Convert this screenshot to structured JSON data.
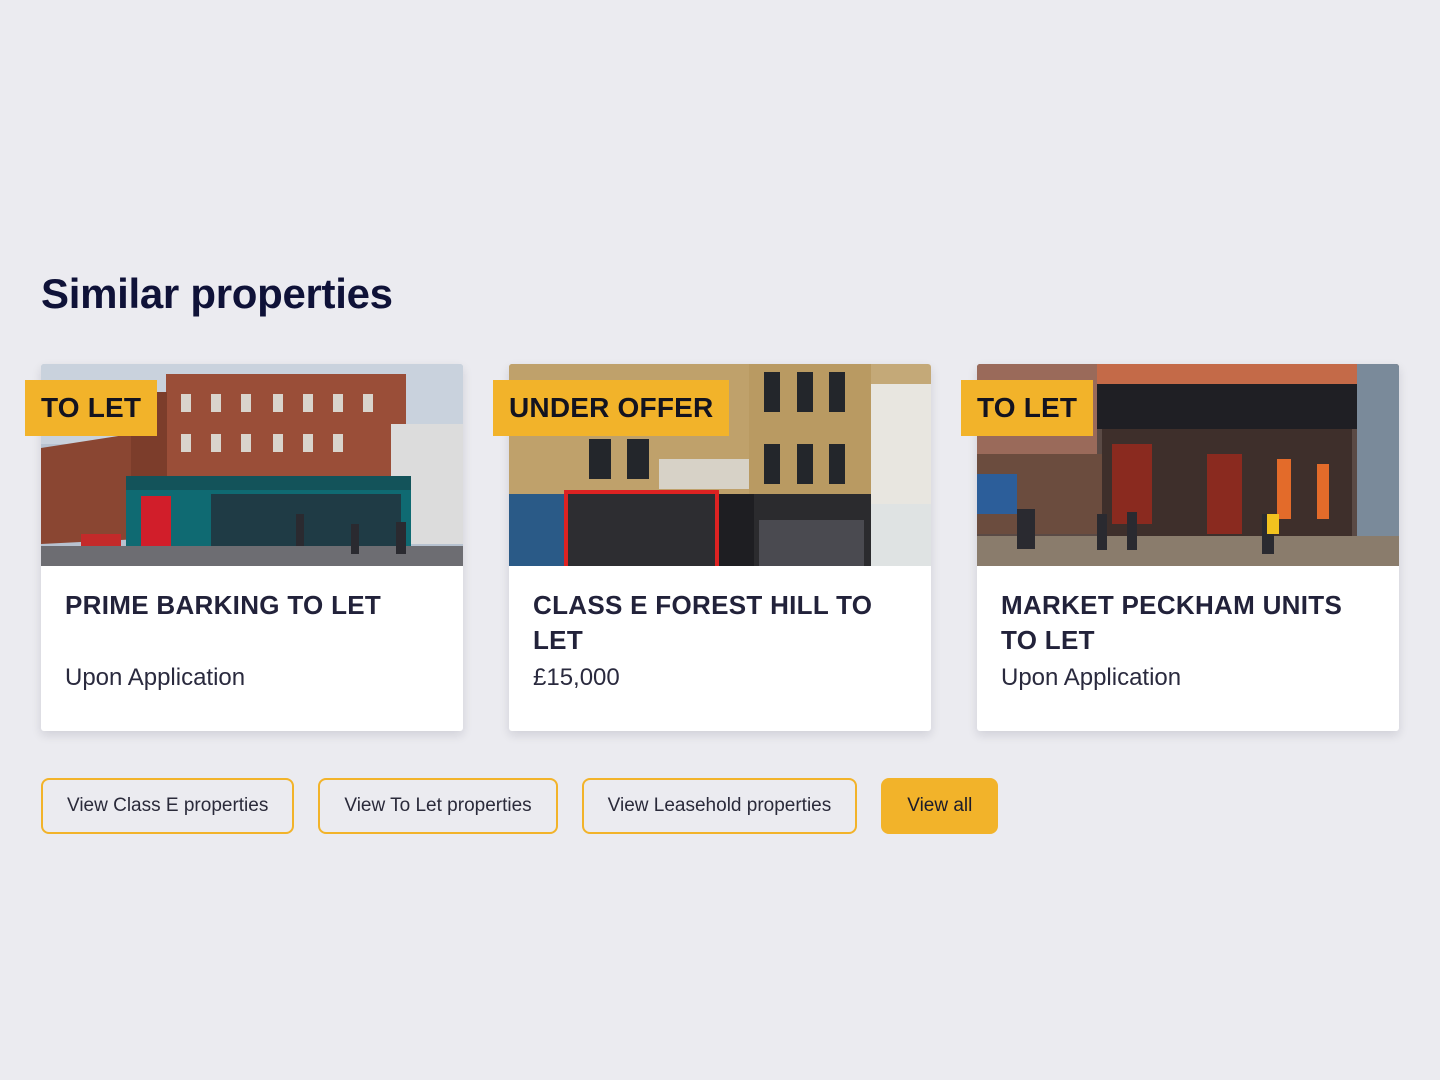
{
  "section": {
    "title": "Similar properties"
  },
  "cards": [
    {
      "badge": "TO LET",
      "title": "PRIME BARKING TO LET",
      "price": "Upon Application"
    },
    {
      "badge": "UNDER OFFER",
      "title": "CLASS E FOREST HILL TO LET",
      "price": "£15,000"
    },
    {
      "badge": "TO LET",
      "title": "MARKET PECKHAM UNITS TO LET",
      "price": "Upon Application"
    }
  ],
  "buttons": {
    "class_e": "View Class E properties",
    "to_let": "View To Let properties",
    "leasehold": "View Leasehold properties",
    "view_all": "View all"
  },
  "colors": {
    "accent": "#f2b32a",
    "background": "#ebebf0",
    "heading": "#0f1238"
  }
}
